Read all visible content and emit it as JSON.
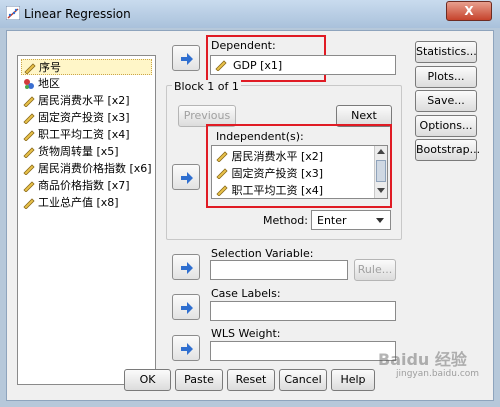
{
  "window": {
    "title": "Linear Regression",
    "close_label": "X"
  },
  "variables": [
    {
      "label": "序号",
      "icon": "ruler-icon",
      "selected": true
    },
    {
      "label": "地区",
      "icon": "nominal-icon",
      "selected": false
    },
    {
      "label": "居民消费水平 [x2]",
      "icon": "ruler-icon",
      "selected": false
    },
    {
      "label": "固定资产投资 [x3]",
      "icon": "ruler-icon",
      "selected": false
    },
    {
      "label": "职工平均工资 [x4]",
      "icon": "ruler-icon",
      "selected": false
    },
    {
      "label": "货物周转量 [x5]",
      "icon": "ruler-icon",
      "selected": false
    },
    {
      "label": "居民消费价格指数 [x6]",
      "icon": "ruler-icon",
      "selected": false
    },
    {
      "label": "商品价格指数 [x7]",
      "icon": "ruler-icon",
      "selected": false
    },
    {
      "label": "工业总产值 [x8]",
      "icon": "ruler-icon",
      "selected": false
    }
  ],
  "dependent": {
    "label": "Dependent:",
    "value": "GDP [x1]"
  },
  "block": {
    "label": "Block 1 of 1",
    "previous_label": "Previous",
    "next_label": "Next",
    "independents_label": "Independent(s):",
    "independents": [
      "居民消费水平 [x2]",
      "固定资产投资 [x3]",
      "职工平均工资 [x4]"
    ]
  },
  "method": {
    "label": "Method:",
    "value": "Enter"
  },
  "selection_variable": {
    "label": "Selection Variable:",
    "value": "",
    "rule_label": "Rule..."
  },
  "case_labels": {
    "label": "Case Labels:",
    "value": ""
  },
  "wls_weight": {
    "label": "WLS Weight:",
    "value": ""
  },
  "side_buttons": [
    "Statistics...",
    "Plots...",
    "Save...",
    "Options...",
    "Bootstrap..."
  ],
  "bottom_buttons": [
    "OK",
    "Paste",
    "Reset",
    "Cancel",
    "Help"
  ],
  "watermark": {
    "text": "Baidu 经验",
    "subtext": "jingyan.baidu.com"
  },
  "colors": {
    "highlight_border": "#e01b24",
    "arrow_blue": "#2f6fd0",
    "selected_item": "#fff6c8"
  }
}
